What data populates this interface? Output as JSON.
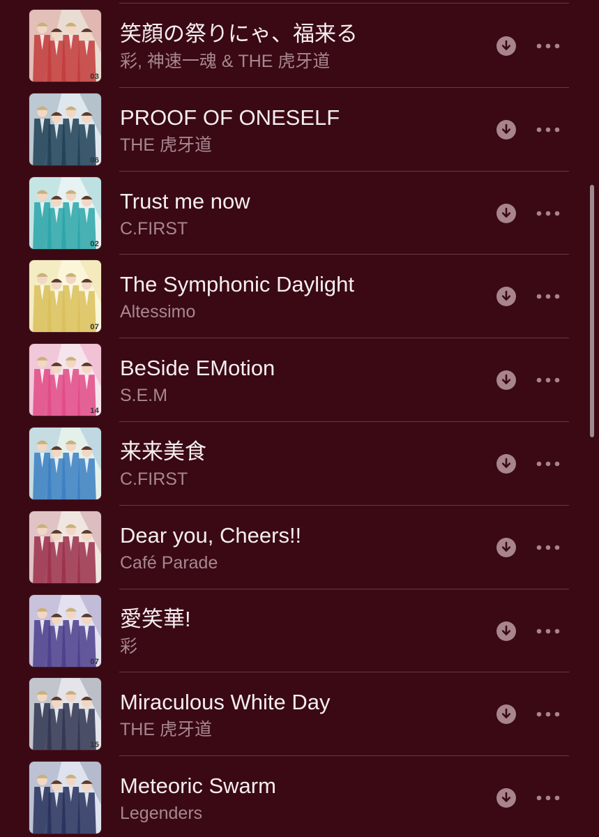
{
  "songs": [
    {
      "title": "笑顔の祭りにゃ、福来る",
      "artist": "彩, 神速一魂 & THE 虎牙道",
      "art_bg": "#e9dcd2",
      "art_accent": "#c23b3b",
      "art_number": "03"
    },
    {
      "title": "PROOF OF ONESELF",
      "artist": "THE 虎牙道",
      "art_bg": "#dfe7ee",
      "art_accent": "#1f3f55",
      "art_number": "06"
    },
    {
      "title": "Trust me now",
      "artist": "C.FIRST",
      "art_bg": "#e7f3f2",
      "art_accent": "#2aa4a8",
      "art_number": "02"
    },
    {
      "title": "The Symphonic Daylight",
      "artist": "Altessimo",
      "art_bg": "#fbf6d9",
      "art_accent": "#d9c05a",
      "art_number": "07"
    },
    {
      "title": "BeSide EMotion",
      "artist": "S.E.M",
      "art_bg": "#f6e4ec",
      "art_accent": "#e04a86",
      "art_number": "14"
    },
    {
      "title": "来来美食",
      "artist": "C.FIRST",
      "art_bg": "#e4f1ea",
      "art_accent": "#3a7fc2",
      "art_number": ""
    },
    {
      "title": "Dear you, Cheers!!",
      "artist": "Café Parade",
      "art_bg": "#f0e6e1",
      "art_accent": "#9a2f4a",
      "art_number": ""
    },
    {
      "title": "愛笑華!",
      "artist": "彩",
      "art_bg": "#e3e0ef",
      "art_accent": "#4b3e8c",
      "art_number": "07"
    },
    {
      "title": "Miraculous White Day",
      "artist": "THE 虎牙道",
      "art_bg": "#e4e4ea",
      "art_accent": "#2f3550",
      "art_number": "15"
    },
    {
      "title": "Meteoric Swarm",
      "artist": "Legenders",
      "art_bg": "#dde2ee",
      "art_accent": "#27305a",
      "art_number": ""
    }
  ],
  "icons": {
    "download": "download-icon",
    "more": "more-icon"
  },
  "colors": {
    "background": "#3a0914",
    "title": "#f4eef0",
    "subtitle": "#a88790",
    "icon": "#a8848d"
  }
}
